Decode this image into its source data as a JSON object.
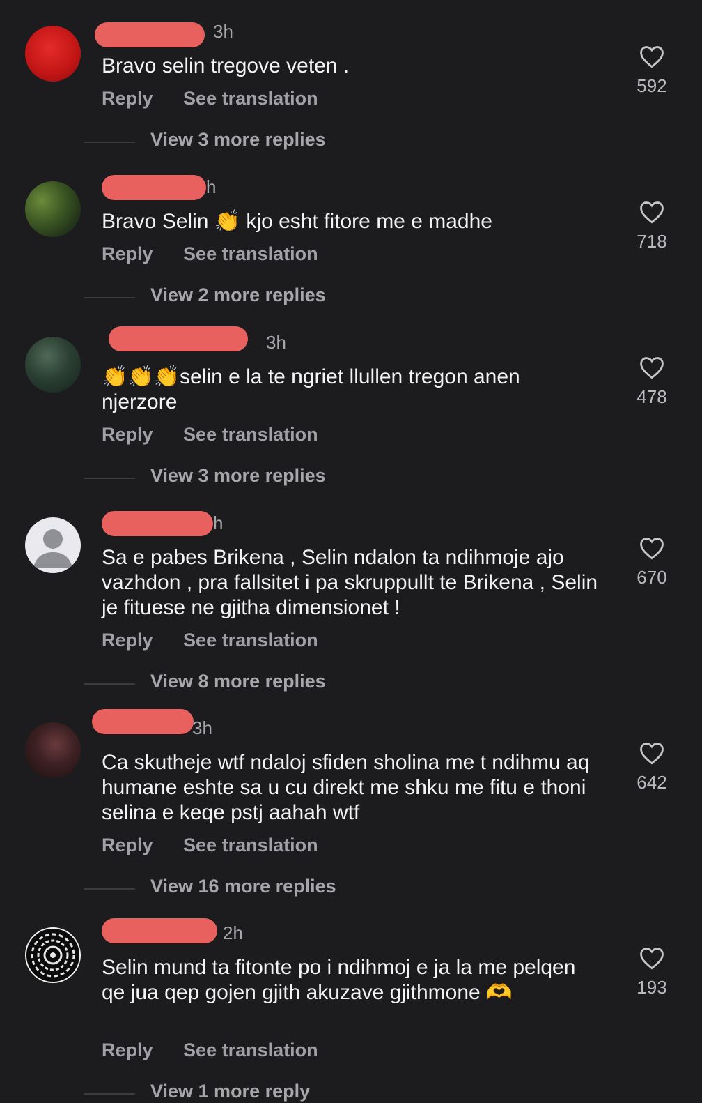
{
  "comments": [
    {
      "time": "3h",
      "text": "Bravo selin tregove veten .",
      "reply": "Reply",
      "see_translation": "See translation",
      "likes": "592",
      "view_more": "View 3 more replies"
    },
    {
      "time": "h",
      "text": "Bravo Selin 👏 kjo esht fitore me e madhe",
      "reply": "Reply",
      "see_translation": "See translation",
      "likes": "718",
      "view_more": "View 2 more replies"
    },
    {
      "time": "3h",
      "text": "👏👏👏selin e la te ngriet llullen tregon anen njerzore",
      "reply": "Reply",
      "see_translation": "See translation",
      "likes": "478",
      "view_more": "View 3 more replies"
    },
    {
      "time": "h",
      "text": "Sa e pabes Brikena , Selin ndalon ta ndihmoje ajo vazhdon , pra fallsitet i pa skruppullt te Brikena , Selin je fituese ne gjitha dimensionet !",
      "reply": "Reply",
      "see_translation": "See translation",
      "likes": "670",
      "view_more": "View 8 more replies"
    },
    {
      "time": "3h",
      "text": "Ca skutheje wtf ndaloj sfiden sholina me t ndihmu aq humane eshte sa u cu direkt me shku me fitu e thoni selina e keqe pstj aahah wtf",
      "reply": "Reply",
      "see_translation": "See translation",
      "likes": "642",
      "view_more": "View 16 more replies"
    },
    {
      "time": "2h",
      "text": "Selin mund ta fitonte po i ndihmoj e ja la me pelqen qe jua qep gojen gjith akuzave gjithmone 🫶",
      "reply": "Reply",
      "see_translation": "See translation",
      "likes": "193",
      "view_more": "View 1 more reply"
    }
  ],
  "icons": {
    "like": "heart-outline-icon",
    "avatar_default": "default-avatar-icon"
  },
  "colors": {
    "background": "#1c1c1f",
    "redaction": "#e8615f",
    "secondary_text": "#a6a6ab"
  }
}
